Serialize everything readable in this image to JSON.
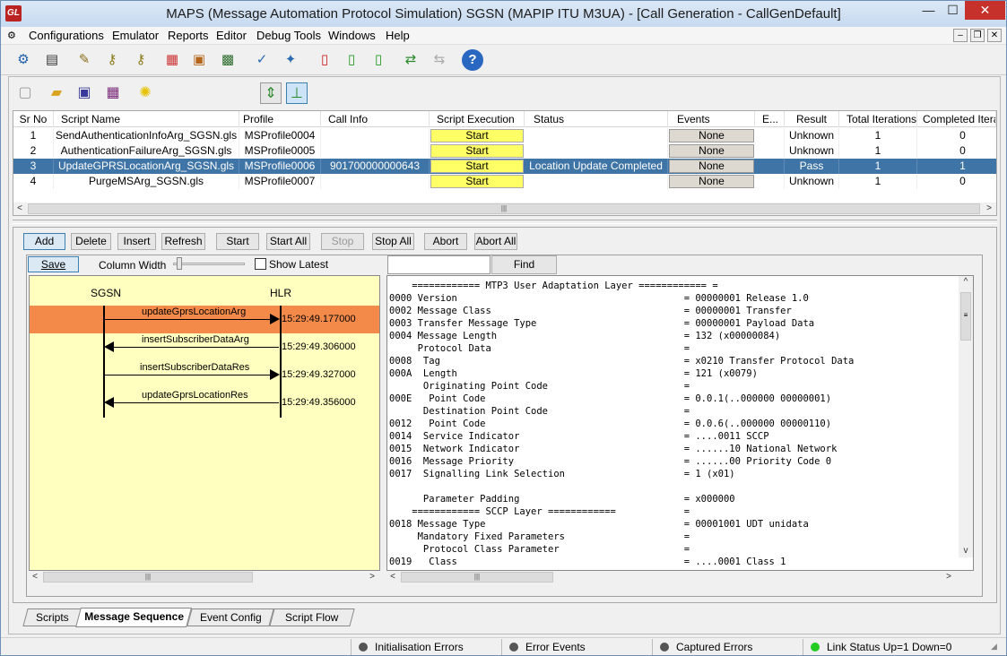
{
  "window": {
    "title": "MAPS (Message Automation Protocol Simulation) SGSN (MAPIP ITU M3UA) - [Call Generation  - CallGenDefault]",
    "app_icon_text": "GL",
    "min_glyph": "—",
    "max_glyph": "☐",
    "close_glyph": "✕"
  },
  "menubar": {
    "items": [
      "Configurations",
      "Emulator",
      "Reports",
      "Editor",
      "Debug Tools",
      "Windows",
      "Help"
    ],
    "mdi_min": "–",
    "mdi_restore": "❐",
    "mdi_close": "✕"
  },
  "toolbar_icons": [
    "settings-gear-icon",
    "notebook-icon",
    "script-edit-icon",
    "keys-icon",
    "keys-double-icon",
    "color-blocks-icon",
    "briefcase-icon",
    "computer-lock-icon",
    "checklist-pen-icon",
    "tools-icon",
    "report-e-icon",
    "report-c-icon",
    "report-p-icon",
    "call-flow-icon",
    "disabled-flow-icon",
    "help-icon"
  ],
  "grid": {
    "headers": [
      "Sr No",
      "Script Name",
      "Profile",
      "Call Info",
      "Script Execution",
      "Status",
      "Events",
      "E...",
      "Result",
      "Total Iterations",
      "Completed Iterati..."
    ],
    "rows": [
      {
        "sr": "1",
        "script": "SendAuthenticationInfoArg_SGSN.gls",
        "profile": "MSProfile0004",
        "call_info": "",
        "exec": "Start",
        "status": "",
        "events": "None",
        "e": "",
        "result": "Unknown",
        "total": "1",
        "completed": "0"
      },
      {
        "sr": "2",
        "script": "AuthenticationFailureArg_SGSN.gls",
        "profile": "MSProfile0005",
        "call_info": "",
        "exec": "Start",
        "status": "",
        "events": "None",
        "e": "",
        "result": "Unknown",
        "total": "1",
        "completed": "0"
      },
      {
        "sr": "3",
        "script": "UpdateGPRSLocationArg_SGSN.gls",
        "profile": "MSProfile0006",
        "call_info": "901700000000643",
        "exec": "Start",
        "status": "Location Update Completed",
        "events": "None",
        "e": "",
        "result": "Pass",
        "total": "1",
        "completed": "1"
      },
      {
        "sr": "4",
        "script": "PurgeMSArg_SGSN.gls",
        "profile": "MSProfile0007",
        "call_info": "",
        "exec": "Start",
        "status": "",
        "events": "None",
        "e": "",
        "result": "Unknown",
        "total": "1",
        "completed": "0"
      }
    ],
    "selected_row": 2
  },
  "actions": {
    "add": "Add",
    "delete": "Delete",
    "insert": "Insert",
    "refresh": "Refresh",
    "start": "Start",
    "start_all": "Start All",
    "stop": "Stop",
    "stop_all": "Stop All",
    "abort": "Abort",
    "abort_all": "Abort All"
  },
  "sequence_panel": {
    "save": "Save",
    "column_width": "Column Width",
    "show_latest": "Show Latest",
    "column_width_level": 0.05,
    "columns": [
      "SGSN",
      "HLR"
    ],
    "messages": [
      {
        "label": "updateGprsLocationArg",
        "direction": "right",
        "time": "15:29:49.177000"
      },
      {
        "label": "insertSubscriberDataArg",
        "direction": "left",
        "time": "15:29:49.306000"
      },
      {
        "label": "insertSubscriberDataRes",
        "direction": "right",
        "time": "15:29:49.327000"
      },
      {
        "label": "updateGprsLocationRes",
        "direction": "left",
        "time": "15:29:49.356000"
      }
    ]
  },
  "decode_panel": {
    "find": "Find",
    "search_value": "",
    "lines": [
      "    ============ MTP3 User Adaptation Layer ============ =",
      "0000 Version                                        = 00000001 Release 1.0",
      "0002 Message Class                                  = 00000001 Transfer",
      "0003 Transfer Message Type                          = 00000001 Payload Data",
      "0004 Message Length                                 = 132 (x00000084)",
      "     Protocol Data                                  =",
      "0008  Tag                                           = x0210 Transfer Protocol Data",
      "000A  Length                                        = 121 (x0079)",
      "      Originating Point Code                        =",
      "000E   Point Code                                   = 0.0.1(..000000 00000001)",
      "      Destination Point Code                        =",
      "0012   Point Code                                   = 0.0.6(..000000 00000110)",
      "0014  Service Indicator                             = ....0011 SCCP",
      "0015  Network Indicator                             = ......10 National Network",
      "0016  Message Priority                              = ......00 Priority Code 0",
      "0017  Signalling Link Selection                     = 1 (x01)",
      "",
      "      Parameter Padding                             = x000000",
      "    ============ SCCP Layer ============            =",
      "0018 Message Type                                   = 00001001 UDT unidata",
      "     Mandatory Fixed Parameters                     =",
      "      Protocol Class Parameter                      =",
      "0019   Class                                        = ....0001 Class 1"
    ]
  },
  "tabs": [
    "Scripts",
    "Message Sequence",
    "Event Config",
    "Script Flow"
  ],
  "active_tab": 1,
  "statusbar": {
    "init_errors": "Initialisation Errors",
    "error_events": "Error Events",
    "captured_errors": "Captured Errors",
    "link_status": "Link Status Up=1 Down=0",
    "colors": {
      "inactive": "#555555",
      "active": "#22cc22"
    }
  },
  "colors": {
    "selected_row": "#3f74a6",
    "start_button": "#ffff66",
    "sequence_bg": "#ffffc0",
    "highlight": "#f48a4a"
  }
}
